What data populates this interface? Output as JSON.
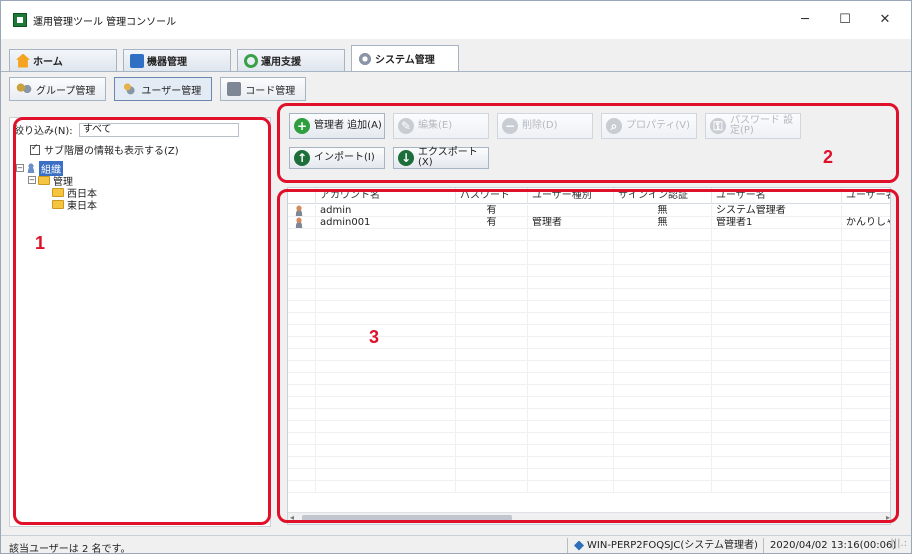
{
  "window": {
    "title": "運用管理ツール 管理コンソール",
    "controls": {
      "minimize": "─",
      "maximize": "☐",
      "close": "✕"
    }
  },
  "main_tabs": [
    {
      "label": "ホーム",
      "icon": "home-icon"
    },
    {
      "label": "機器管理",
      "icon": "monitor-icon"
    },
    {
      "label": "運用支援",
      "icon": "cycle-icon"
    },
    {
      "label": "システム管理",
      "icon": "gears-icon",
      "active": true
    }
  ],
  "sub_tabs": [
    {
      "label": "グループ管理",
      "icon": "group-icon"
    },
    {
      "label": "ユーザー管理",
      "icon": "user-icon",
      "active": true
    },
    {
      "label": "コード管理",
      "icon": "code-icon"
    }
  ],
  "left_panel": {
    "filter_label": "絞り込み(N):",
    "filter_value": "すべて",
    "show_sub_label": "サブ階層の情報も表示する(Z)",
    "show_sub_checked": true,
    "tree": [
      {
        "label": "組織",
        "level": 0,
        "expander": "−",
        "type": "org",
        "selected": true
      },
      {
        "label": "管理",
        "level": 1,
        "expander": "−",
        "type": "folder"
      },
      {
        "label": "西日本",
        "level": 2,
        "type": "folder"
      },
      {
        "label": "東日本",
        "level": 2,
        "type": "folder"
      }
    ]
  },
  "toolbar": {
    "add_label": "管理者 追加(A)",
    "edit_label": "編集(E)",
    "delete_label": "削除(D)",
    "property_label": "プロパティ(V)",
    "password_label": "パスワード 設定(P)",
    "import_label": "インポート(I)",
    "export_label": "エクスポート(X)"
  },
  "table": {
    "columns": [
      "",
      "アカウント名",
      "パスワード",
      "ユーザー種別",
      "サインイン認証",
      "ユーザー名",
      "ユーザー名(か"
    ],
    "rows": [
      [
        "",
        "admin",
        "有",
        "",
        "無",
        "システム管理者",
        ""
      ],
      [
        "",
        "admin001",
        "有",
        "管理者",
        "無",
        "管理者1",
        "かんりしゃ"
      ]
    ]
  },
  "annotations": {
    "left": "1",
    "toolbar": "2",
    "table": "3"
  },
  "statusbar": {
    "user_count": "該当ユーザーは 2 名です。",
    "server": "WIN-PERP2FOQSJC(システム管理者)",
    "datetime": "2020/04/02 13:16(00:06)"
  },
  "colors": {
    "annotation": "#e0102a",
    "selection": "#3a6fc4",
    "add_button": "#2e9e3e"
  }
}
